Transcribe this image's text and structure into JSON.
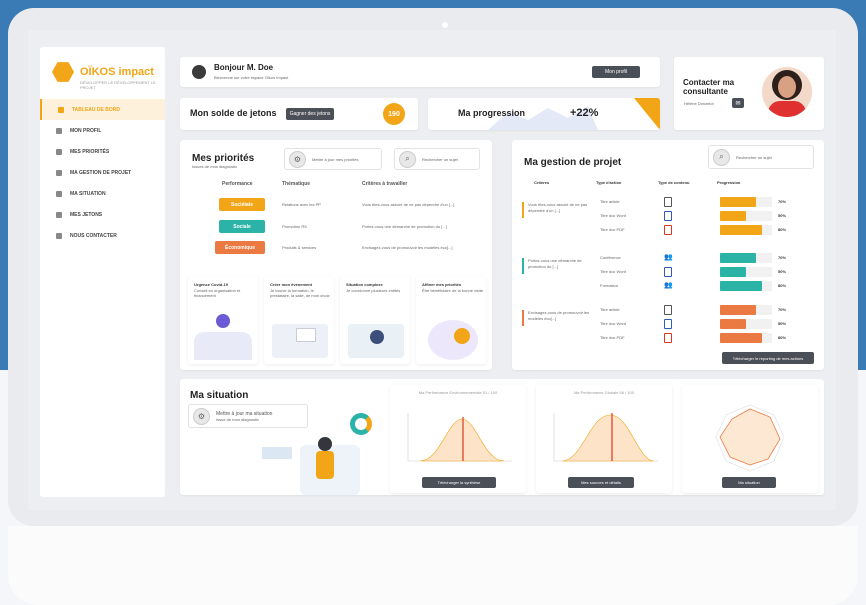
{
  "brand": {
    "name": "OÏKOS impact",
    "tagline": "DÉVELOPPER LE DÉVELOPPEMENT LE PROJET"
  },
  "sidebar": {
    "items": [
      {
        "label": "TABLEAU DE BORD",
        "icon": "dashboard-icon"
      },
      {
        "label": "MON PROFIL",
        "icon": "user-icon"
      },
      {
        "label": "MES PRIORITÉS",
        "icon": "list-icon"
      },
      {
        "label": "MA GESTION DE PROJET",
        "icon": "folder-icon"
      },
      {
        "label": "MA SITUATION",
        "icon": "chart-icon"
      },
      {
        "label": "MES JETONS",
        "icon": "token-icon"
      },
      {
        "label": "NOUS CONTACTER",
        "icon": "mail-icon"
      }
    ]
  },
  "greeting": {
    "title": "Bonjour M. Doe",
    "subtitle": "Bienvenue sur votre espace Oïkos Impact",
    "button": "Mon profil"
  },
  "tokens": {
    "label": "Mon solde de jetons",
    "button": "Gagner des jetons",
    "value": "190"
  },
  "progress": {
    "label": "Ma progression",
    "value": "+22%"
  },
  "contact": {
    "title": "Contacter ma consultante",
    "name": "Hélène Donzelot",
    "accent": "#e03131"
  },
  "priorities": {
    "title": "Mes priorités",
    "subtitle": "Issues de mon diagnostic",
    "update_button": "Mettre à jour mes priorités",
    "search_button": "Rechercher un sujet",
    "columns": [
      "Performance",
      "Thématique",
      "Critères à travailler"
    ],
    "rows": [
      {
        "pill": "Sociétale",
        "color": "#f2a516",
        "theme": "Relations avec les PP",
        "criteria": "Vous êtes-vous assuré de ne pas dépendre d'un [...]"
      },
      {
        "pill": "Sociale",
        "color": "#2bb3a8",
        "theme": "Promotion RS",
        "criteria": "Portez-vous une démarche de promotion du [...]"
      },
      {
        "pill": "Économique",
        "color": "#ea7a41",
        "theme": "Produits & services",
        "criteria": "Envisagez-vous de promouvoir les modèles éco[...]"
      }
    ],
    "cards": [
      {
        "title": "Urgence Covid-19",
        "text": "Conseil en organisation et financement"
      },
      {
        "title": "Créer mon événement",
        "text": "Je trouve la formation, le prestataire, la salle, de mon choix"
      },
      {
        "title": "Situation complexe",
        "text": "Je coordonne plusieurs entités"
      },
      {
        "title": "Affiner mes priorités",
        "text": "Être bénéficiaire de la bonne visite"
      }
    ]
  },
  "project": {
    "title": "Ma gestion de projet",
    "search_button": "Rechercher un sujet",
    "columns": [
      "Critères",
      "Type d'action",
      "Type de contenu",
      "Progression"
    ],
    "groups": [
      {
        "criteria": "Vous êtes-vous assuré de ne pas dépendre d'un [...]",
        "color": "#f2a516",
        "rows": [
          {
            "action": "Titre article",
            "icon": "document-icon",
            "progress": 70,
            "label": "70%"
          },
          {
            "action": "Titre doc Word",
            "icon": "word-icon",
            "progress": 50,
            "label": "50%"
          },
          {
            "action": "Titre doc PDF",
            "icon": "pdf-icon",
            "progress": 80,
            "label": "80%"
          }
        ]
      },
      {
        "criteria": "Portez-vous une démarche de promotion du [...]",
        "color": "#2bb3a8",
        "rows": [
          {
            "action": "Conférence",
            "icon": "people-icon",
            "progress": 70,
            "label": "70%"
          },
          {
            "action": "Titre doc Word",
            "icon": "word-icon",
            "progress": 50,
            "label": "50%"
          },
          {
            "action": "Formation",
            "icon": "people-icon",
            "progress": 80,
            "label": "80%"
          }
        ]
      },
      {
        "criteria": "Envisagez-vous de promouvoir les modèles éco[...]",
        "color": "#ea7a41",
        "rows": [
          {
            "action": "Titre article",
            "icon": "document-icon",
            "progress": 70,
            "label": "70%"
          },
          {
            "action": "Titre doc Word",
            "icon": "word-icon",
            "progress": 50,
            "label": "50%"
          },
          {
            "action": "Titre doc PDF",
            "icon": "pdf-icon",
            "progress": 80,
            "label": "80%"
          }
        ]
      }
    ],
    "download_button": "Télécharger le reporting de mes actions"
  },
  "situation": {
    "title": "Ma situation",
    "update_button": "Mettre à jour ma situation",
    "update_sub": "Issue de mon diagnostic",
    "charts": [
      {
        "title": "Ma Performance Environnementale 51 / 100",
        "button": "Télécharger la synthèse"
      },
      {
        "title": "Ma Performance Globale 56 / 100",
        "button": "Mes sources et détails"
      },
      {
        "title": "",
        "button": "Ma situation"
      }
    ]
  }
}
